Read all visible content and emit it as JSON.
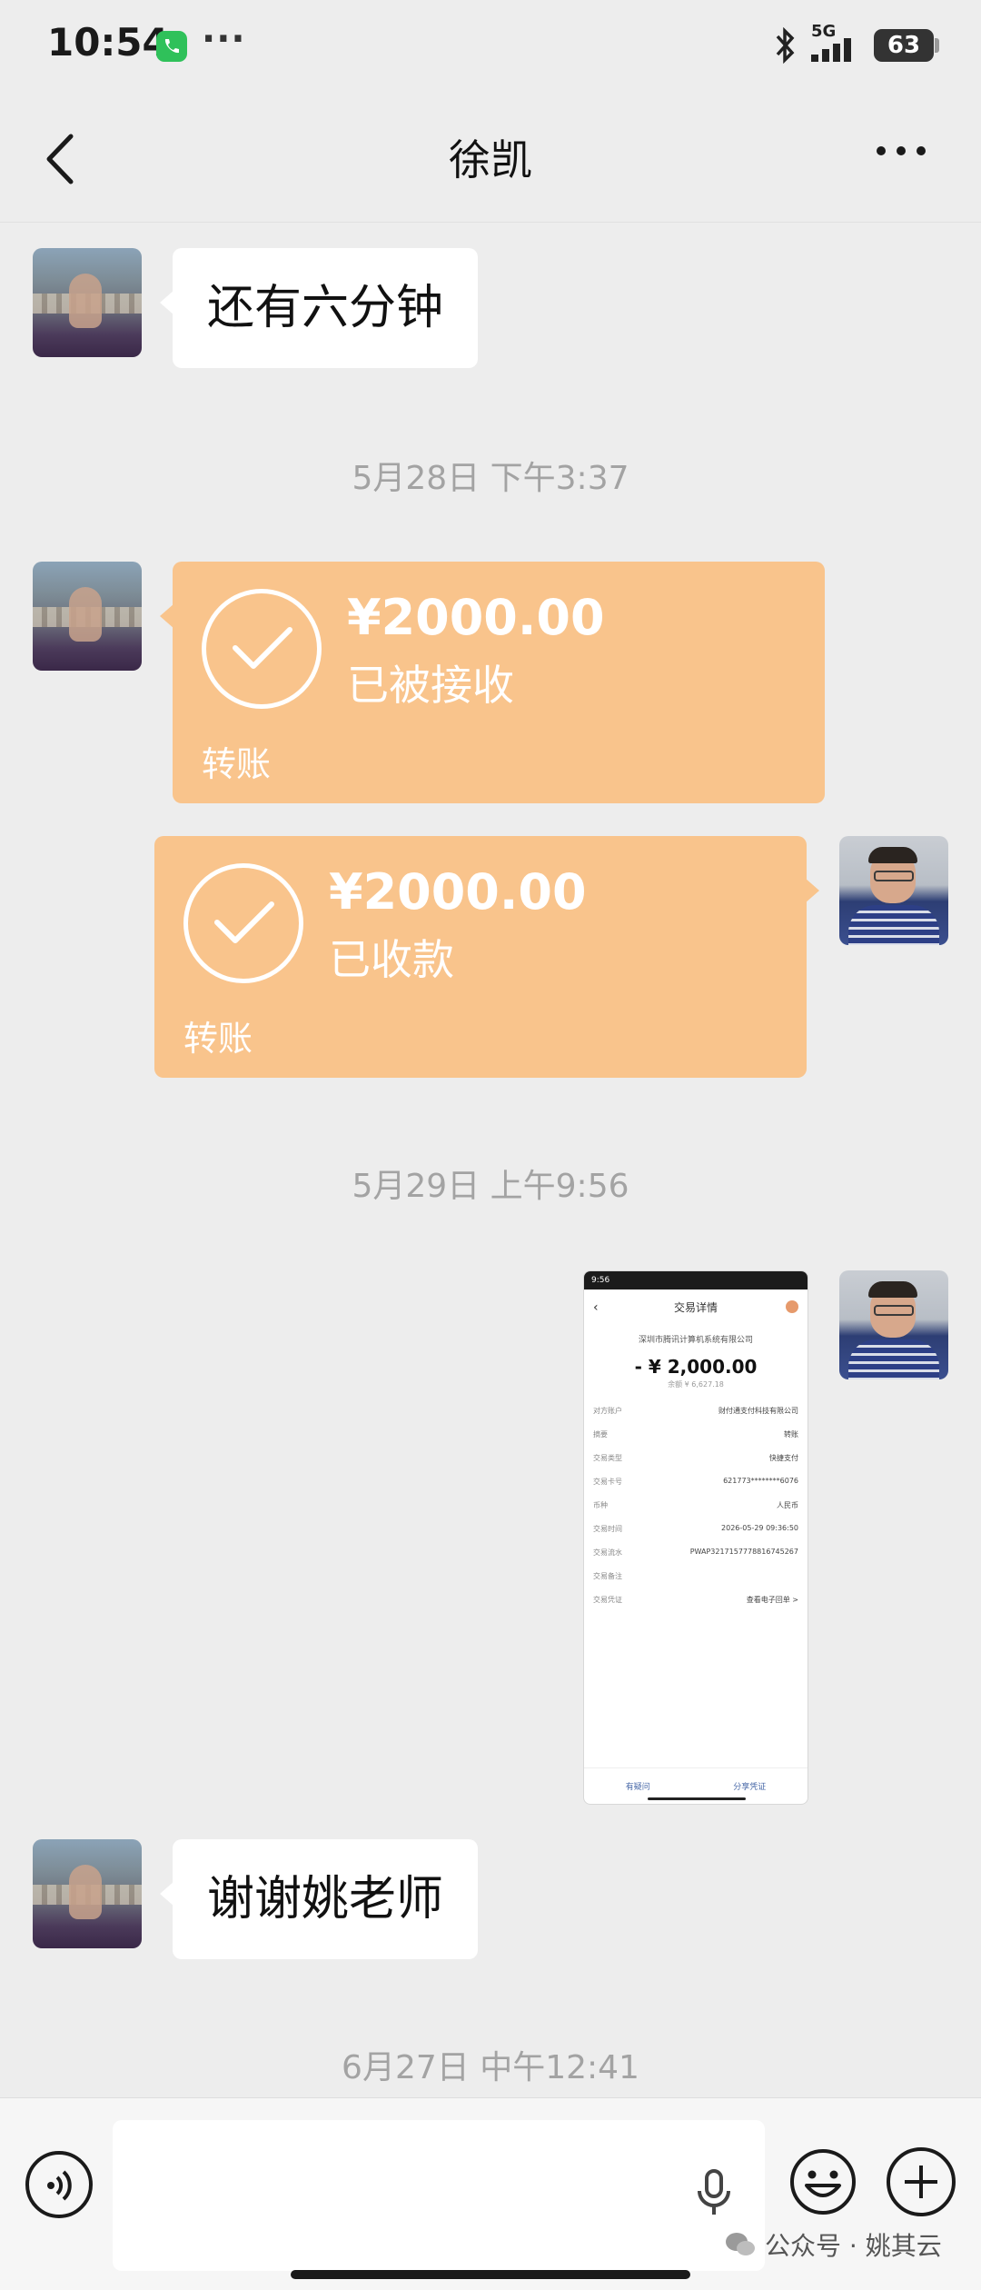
{
  "status_bar": {
    "time": "10:54",
    "network": "5G",
    "battery": "63",
    "overflow": "···"
  },
  "header": {
    "title": "徐凯"
  },
  "messages": {
    "msg1_text": "还有六分钟",
    "ts1": "5月28日 下午3:37",
    "transfer_in": {
      "amount": "¥2000.00",
      "status": "已被接收",
      "label": "转账"
    },
    "transfer_out": {
      "amount": "¥2000.00",
      "status": "已收款",
      "label": "转账"
    },
    "ts2": "5月29日 上午9:56",
    "screenshot": {
      "status_time": "9:56",
      "title": "交易详情",
      "merchant": "深圳市腾讯计算机系统有限公司",
      "amount": "- ¥ 2,000.00",
      "sub": "余额 ¥ 6,627.18",
      "rows": [
        {
          "k": "对方账户",
          "v": "财付通支付科技有限公司"
        },
        {
          "k": "摘要",
          "v": "转账"
        },
        {
          "k": "交易类型",
          "v": "快捷支付"
        },
        {
          "k": "交易卡号",
          "v": "621773********6076"
        },
        {
          "k": "币种",
          "v": "人民币"
        },
        {
          "k": "交易时间",
          "v": "2026-05-29 09:36:50"
        },
        {
          "k": "交易流水",
          "v": "PWAP3217157778816745267"
        },
        {
          "k": "交易备注",
          "v": ""
        },
        {
          "k": "交易凭证",
          "v": "查看电子回单 >"
        }
      ],
      "foot_left": "有疑问",
      "foot_right": "分享凭证"
    },
    "msg2_text": "谢谢姚老师",
    "ts3": "6月27日 中午12:41"
  },
  "input": {
    "placeholder": ""
  },
  "watermark": "公众号 · 姚其云",
  "colors": {
    "background": "#ededed",
    "transfer": "#f9c48c",
    "bubble": "#ffffff",
    "timestamp": "#a3a3a3"
  },
  "icons": [
    "phone-icon",
    "bluetooth-icon",
    "signal-icon",
    "back-icon",
    "more-icon",
    "check-icon",
    "voice-icon",
    "mic-icon",
    "emoji-icon",
    "plus-icon"
  ]
}
